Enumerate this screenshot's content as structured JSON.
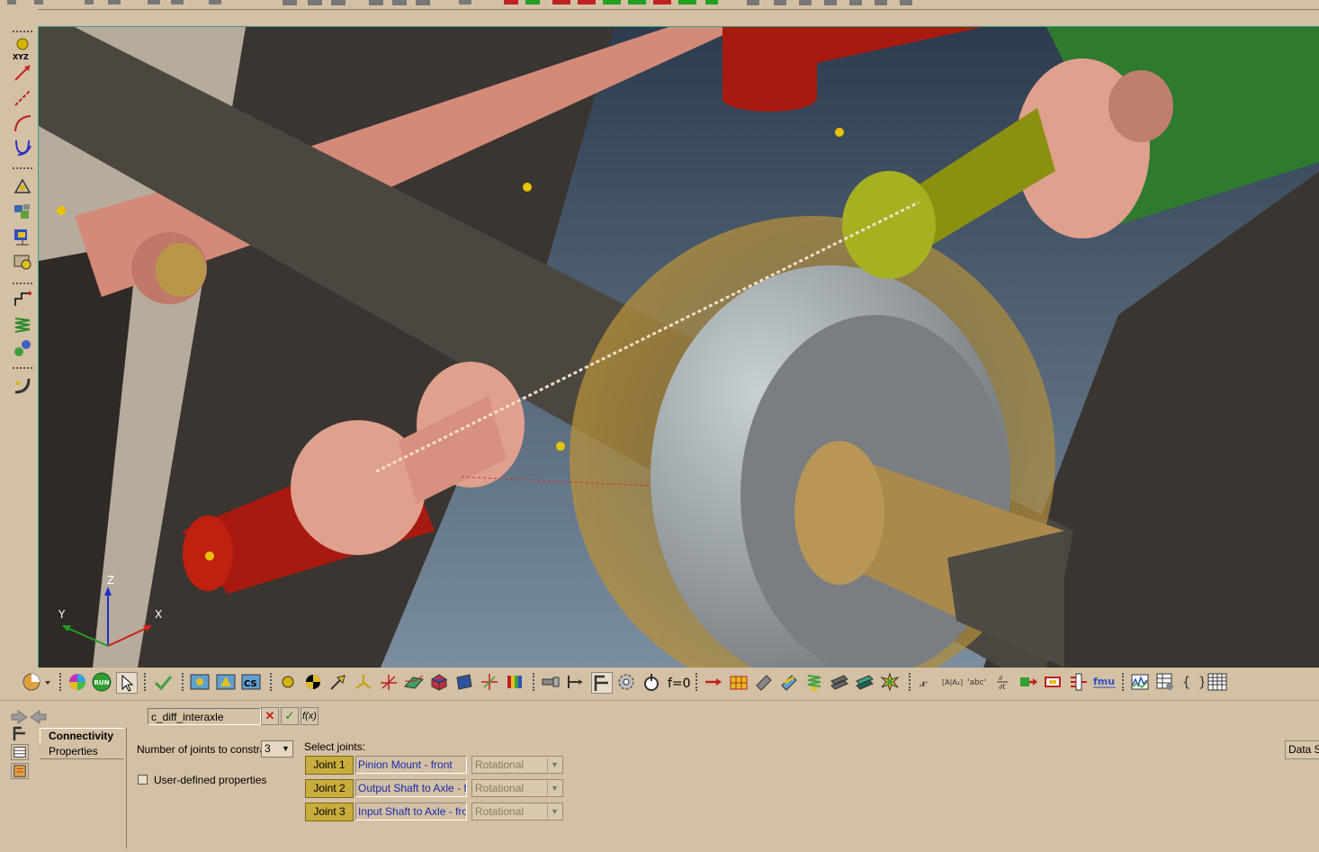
{
  "panel": {
    "name_field": "c_diff_interaxle",
    "tabs": [
      "Connectivity",
      "Properties"
    ],
    "num_joints_label": "Number of joints to constrain:",
    "num_joints_value": "3",
    "user_defined_label": "User-defined properties",
    "select_joints_label": "Select joints:",
    "joints": [
      {
        "button": "Joint 1",
        "name": "Pinion Mount - front",
        "type": "Rotational"
      },
      {
        "button": "Joint 2",
        "name": "Output Shaft to Axle - fror",
        "type": "Rotational"
      },
      {
        "button": "Joint 3",
        "name": "Input Shaft to Axle - front",
        "type": "Rotational"
      }
    ],
    "data_button": "Data Sc"
  },
  "left_toolbar": {
    "xyz_label": "XYZ"
  },
  "bottom_toolbar": {
    "run_label": "RUN",
    "cs_label": "CS",
    "f0_label": "f=0",
    "aa_label": "[A|A₂]",
    "abc_label": "'abc'",
    "fmu_label": "fmu",
    "braces_label": "{ }",
    "x_label": "𝓍"
  },
  "triad": {
    "x": "X",
    "y": "Y",
    "z": "Z"
  },
  "colors": {
    "background": "#d4c0a4",
    "joint_button": "#c7ad3c",
    "joint_text": "#1a2bb0",
    "viewport_border": "#3aa08a"
  }
}
